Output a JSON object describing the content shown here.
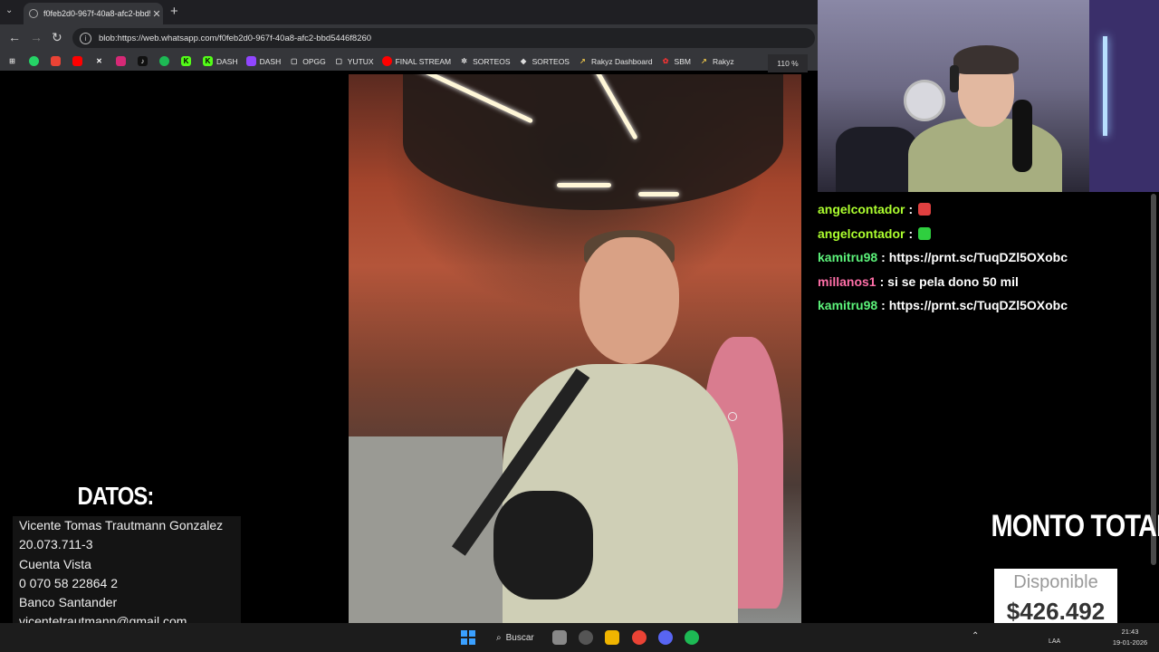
{
  "browser": {
    "tab_title": "f0feb2d0-967f-40a8-afc2-bbd5",
    "url": "blob:https://web.whatsapp.com/f0feb2d0-967f-40a8-afc2-bbd5446f8260",
    "zoom": "110 %",
    "bookmarks": [
      {
        "label": "DASH",
        "icon": "kick-icon",
        "color": "#53fc18"
      },
      {
        "label": "DASH",
        "icon": "twitch-icon",
        "color": "#9146ff"
      },
      {
        "label": "OPGG",
        "icon": "folder-icon",
        "color": "#35363a"
      },
      {
        "label": "YUTUX",
        "icon": "folder-icon",
        "color": "#35363a"
      },
      {
        "label": "FINAL STREAM",
        "icon": "youtube-icon",
        "color": "#ff0000"
      },
      {
        "label": "SORTEOS",
        "icon": "gear-icon",
        "color": "#35363a"
      },
      {
        "label": "SORTEOS",
        "icon": "diamond-icon",
        "color": "#35363a"
      },
      {
        "label": "Rakyz Dashboard",
        "icon": "rakyz-icon",
        "color": "#35363a"
      },
      {
        "label": "SBM",
        "icon": "sbm-icon",
        "color": "#35363a"
      },
      {
        "label": "Rakyz",
        "icon": "rakyz-icon",
        "color": "#35363a"
      }
    ]
  },
  "chat": [
    {
      "user": "angelcontador",
      "sep": ":",
      "text": "",
      "user_color": "#adff2f",
      "emote_color": "#e04040"
    },
    {
      "user": "angelcontador",
      "sep": ":",
      "text": "",
      "user_color": "#adff2f",
      "emote_color": "#2fcf3f"
    },
    {
      "user": "kamitru98",
      "sep": ":",
      "text": "https://prnt.sc/TuqDZl5OXobc",
      "user_color": "#5cf27a",
      "emote_color": ""
    },
    {
      "user": "millanos1",
      "sep": ":",
      "text": "si se pela dono 50 mil",
      "user_color": "#ff6fa8",
      "emote_color": ""
    },
    {
      "user": "kamitru98",
      "sep": ":",
      "text": "https://prnt.sc/TuqDZl5OXobc",
      "user_color": "#5cf27a",
      "emote_color": ""
    }
  ],
  "datos": {
    "title": "DATOS:",
    "lines": [
      "Vicente Tomas Trautmann Gonzalez",
      "20.073.711-3",
      "Cuenta Vista",
      "0 070 58 22864 2",
      "Banco Santander",
      "vicentetrautmann@gmail.com"
    ]
  },
  "monto": {
    "title": "MONTO TOTAL:",
    "label": "Disponible",
    "amount": "$426.492"
  },
  "taskbar": {
    "search_label": "Buscar",
    "lang": "LAA",
    "time": "21:43",
    "date": "19-01-2026"
  }
}
